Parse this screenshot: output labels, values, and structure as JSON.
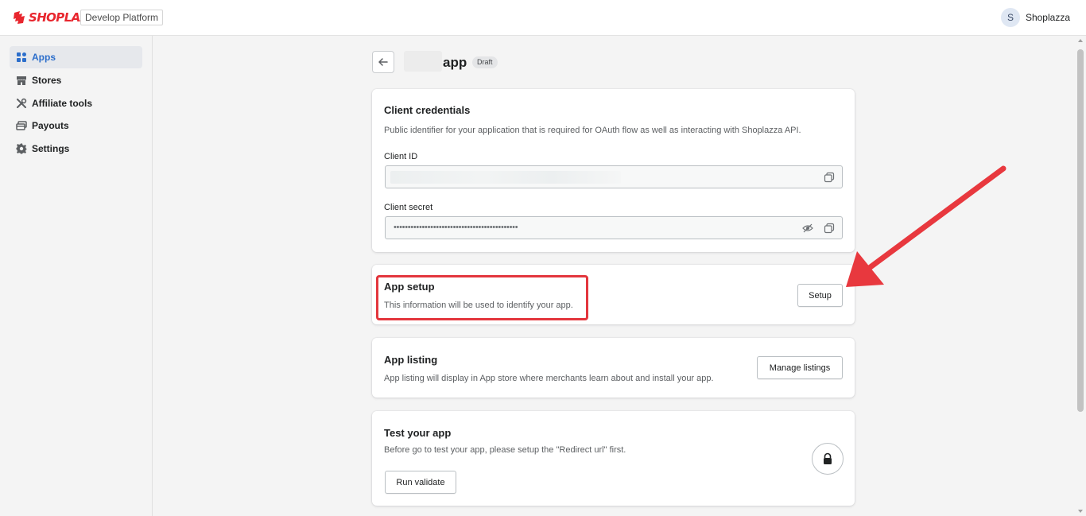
{
  "topbar": {
    "brand_name": "SHOPLAZZA",
    "platform_tag": "Develop Platform",
    "user_initial": "S",
    "user_name": "Shoplazza"
  },
  "sidebar": {
    "items": [
      {
        "label": "Apps",
        "icon": "apps-icon",
        "active": true
      },
      {
        "label": "Stores",
        "icon": "store-icon",
        "active": false
      },
      {
        "label": "Affiliate tools",
        "icon": "tools-icon",
        "active": false
      },
      {
        "label": "Payouts",
        "icon": "payouts-icon",
        "active": false
      },
      {
        "label": "Settings",
        "icon": "settings-icon",
        "active": false
      }
    ]
  },
  "header": {
    "title": "app",
    "status": "Draft"
  },
  "credentials": {
    "title": "Client credentials",
    "description": "Public identifier for your application that is required for OAuth flow as well as interacting with Shoplazza API.",
    "client_id_label": "Client ID",
    "client_secret_label": "Client secret",
    "client_secret_value": "••••••••••••••••••••••••••••••••••••••••••••"
  },
  "app_setup": {
    "title": "App setup",
    "description": "This information will be used to identify your app.",
    "button": "Setup"
  },
  "app_listing": {
    "title": "App listing",
    "description": "App listing will display in App store where merchants learn about and install your app.",
    "button": "Manage listings"
  },
  "test_app": {
    "title": "Test your app",
    "description": "Before go to test your app, please setup the \"Redirect url\" first.",
    "button": "Run validate"
  },
  "colors": {
    "brand": "#e8262e",
    "accent": "#2c6ecb",
    "annotation": "#e3363d"
  }
}
